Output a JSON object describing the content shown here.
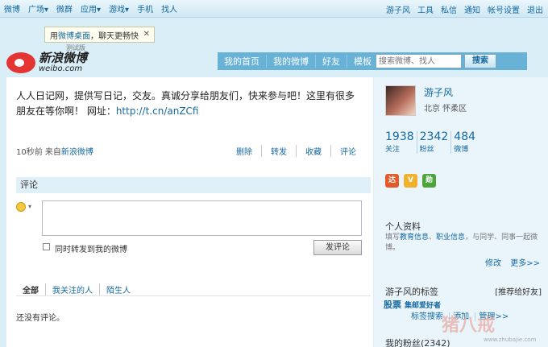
{
  "topbar": {
    "left_items": [
      "微博",
      "广场▾",
      "微群",
      "应用▾",
      "游戏▾",
      "手机",
      "找人"
    ],
    "right_items": [
      "游子风",
      "工具",
      "私信",
      "通知",
      "帐号设置",
      "退出"
    ]
  },
  "tooltip": {
    "prefix": "用",
    "highlight": "微博桌面",
    "suffix": "，聊天更畅快",
    "close": "✕",
    "under": "测试版"
  },
  "logo": {
    "title": "新浪微博",
    "url": "weibo.com"
  },
  "nav": {
    "items": [
      "我的首页",
      "我的微博",
      "好友",
      "模板"
    ],
    "search_placeholder": "搜索微博、找人",
    "search_button": "搜索"
  },
  "post": {
    "text": "人人日记网，提供写日记，交友。真诚分享给朋友们，快来参与吧！这里有很多朋友在等你啊！ 网址：",
    "link": "http://t.cn/anZCfi",
    "time": "10秒前",
    "source_prefix": "来自",
    "source": "新浪微博",
    "actions": [
      "删除",
      "转发",
      "收藏",
      "评论"
    ]
  },
  "comment": {
    "header": "评论",
    "forward_label": "同时转发到我的微博",
    "submit": "发评论",
    "filters": [
      "全部",
      "我关注的人",
      "陌生人"
    ],
    "empty": "还没有评论。"
  },
  "profile": {
    "name": "游子风",
    "location": "北京  怀柔区",
    "stats": [
      {
        "num": "1938",
        "label": "关注"
      },
      {
        "num": "2342",
        "label": "粉丝"
      },
      {
        "num": "484",
        "label": "微博"
      }
    ],
    "badges": [
      "达",
      "V",
      "勋"
    ],
    "section_title": "个人资料",
    "desc_prefix": "填写",
    "desc_link1": "教育信息",
    "desc_mid": "、",
    "desc_link2": "职业信息",
    "desc_suffix": "，与同学、同事一起微博。",
    "edit": "修改",
    "more": "更多>>",
    "tags_title": "游子风的标签",
    "tags_recommend": "[推荐给好友]",
    "tag1": "股票",
    "tag2": "集邮爱好者",
    "tag_actions": [
      "标签搜索",
      "添加",
      "管理>>"
    ],
    "fans_title": "我的粉丝(2342)"
  },
  "watermark": {
    "text": "猪八戒",
    "url": "www.zhubajie.com"
  }
}
